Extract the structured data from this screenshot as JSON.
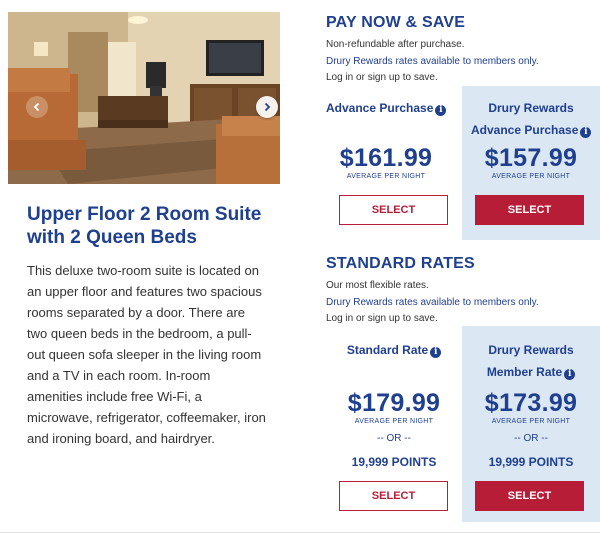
{
  "room": {
    "title": "Upper Floor 2 Room Suite with 2 Queen Beds",
    "description": "This deluxe two-room suite is located on an upper floor and features two spacious rooms separated by a door. There are two queen beds in the bedroom, a pull-out queen sofa sleeper in the living room and a TV in each room. In-room amenities include free Wi-Fi, a microwave, refrigerator, coffeemaker, iron and ironing board, and hairdryer.",
    "photo_alt": "suite-living-room-photo"
  },
  "pay_now": {
    "title": "PAY NOW & SAVE",
    "note1": "Non-refundable after purchase.",
    "note2": "Drury Rewards rates available to members only.",
    "note3": "Log in or sign up to save.",
    "standard": {
      "name": "Advance Purchase",
      "price": "$161.99",
      "per_night": "AVERAGE PER NIGHT",
      "button": "SELECT"
    },
    "member": {
      "name_line1": "Drury Rewards",
      "name_line2": "Advance Purchase",
      "price": "$157.99",
      "per_night": "AVERAGE PER NIGHT",
      "button": "SELECT"
    }
  },
  "standard_rates": {
    "title": "STANDARD RATES",
    "note1": "Our most flexible rates.",
    "note2": "Drury Rewards rates available to members only.",
    "note3": "Log in or sign up to save.",
    "standard": {
      "name": "Standard Rate",
      "price": "$179.99",
      "per_night": "AVERAGE PER NIGHT",
      "or": "-- OR --",
      "points": "19,999 POINTS",
      "button": "SELECT"
    },
    "member": {
      "name_line1": "Drury Rewards",
      "name_line2": "Member Rate",
      "price": "$173.99",
      "per_night": "AVERAGE PER NIGHT",
      "or": "-- OR --",
      "points": "19,999 POINTS",
      "button": "SELECT"
    }
  },
  "icons": {
    "info": "i",
    "carousel_prev": "chevron-left-icon",
    "carousel_next": "chevron-right-icon"
  },
  "colors": {
    "brand_blue": "#1f3f8f",
    "brand_red": "#b81d37",
    "member_panel": "#dbe7f3"
  }
}
